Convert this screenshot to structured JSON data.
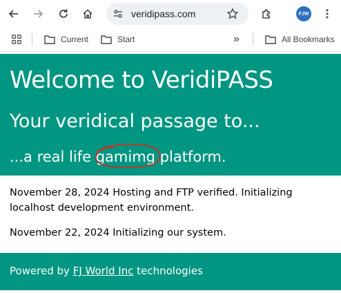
{
  "browser": {
    "url": "veridipass.com",
    "avatar_initials": "FJW",
    "icons": [
      "back-icon",
      "forward-icon",
      "reload-icon",
      "home-icon",
      "site-info-icon",
      "bookmark-star-icon",
      "extensions-icon",
      "menu-icon"
    ]
  },
  "bookmarks": {
    "items": [
      {
        "label": "Current"
      },
      {
        "label": "Start"
      }
    ],
    "overflow": "»",
    "all_bookmarks": "All Bookmarks"
  },
  "hero": {
    "title": "Welcome to VeridiPASS",
    "subtitle": "Your veridical passage to...",
    "tagline_prefix": "...a real life ",
    "tagline_circled": "gamimg",
    "tagline_suffix": " platform.",
    "background_color": "#009682",
    "annotation_color": "#c0392b"
  },
  "news": {
    "items": [
      {
        "text": "November 28, 2024 Hosting and FTP verified. Initializing localhost development environment."
      },
      {
        "text": "November 22, 2024 Initializing our system."
      }
    ]
  },
  "footer": {
    "prefix": "Powered by ",
    "link": "FJ World Inc",
    "suffix": " technologies"
  }
}
